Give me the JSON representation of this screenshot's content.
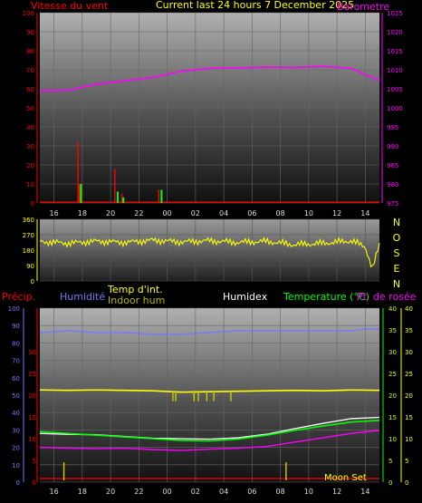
{
  "title": "Current last 24 hours 7 December 2025",
  "x_tick_labels": [
    "16",
    "18",
    "20",
    "22",
    "00",
    "02",
    "04",
    "06",
    "08",
    "10",
    "12",
    "14"
  ],
  "colors": {
    "wind": "#ff0000",
    "gust": "#00ff00",
    "barometer": "#ff00ff",
    "direction": "#ffff00",
    "rain": "#ff0000",
    "humidity": "#7777ff",
    "temp_int": "#ffff00",
    "indoor_hum": "#cccc00",
    "humidex": "#ffffff",
    "temperature": "#00ff00",
    "dewpoint": "#ff00ff"
  },
  "chart_data": [
    {
      "type": "line",
      "left_axis_label": "Vitesse du vent",
      "right_axis_label": "Barometre",
      "left_ticks": [
        "0",
        "10",
        "20",
        "30",
        "40",
        "50",
        "60",
        "70",
        "80",
        "90",
        "100"
      ],
      "right_ticks": [
        "975",
        "980",
        "985",
        "990",
        "995",
        "1000",
        "1005",
        "1010",
        "1015",
        "1020",
        "1025"
      ],
      "ylim_left": [
        0,
        100
      ],
      "ylim_right": [
        975,
        1025
      ],
      "xlim_hours": [
        15,
        39
      ],
      "series": [
        {
          "axis": "right",
          "x": [
            15,
            17,
            19,
            21,
            23,
            25,
            27,
            29,
            31,
            33,
            35,
            37,
            38,
            39
          ],
          "y": [
            1004.5,
            1004.6,
            1006.2,
            1007.1,
            1008.0,
            1009.6,
            1010.4,
            1010.5,
            1010.7,
            1010.6,
            1010.9,
            1010.4,
            1008.7,
            1007.2
          ]
        },
        {
          "axis": "left",
          "x": [
            17.7,
            17.8,
            20.3,
            20.8,
            23.4
          ],
          "y": [
            32,
            10,
            18,
            5,
            7
          ]
        },
        {
          "axis": "left",
          "x": [
            17.9,
            20.5,
            20.9,
            23.6
          ],
          "y": [
            10,
            6,
            3,
            7
          ]
        }
      ]
    },
    {
      "type": "line",
      "right_axis_letters": [
        "N",
        "O",
        "S",
        "E",
        "N"
      ],
      "left_ticks": [
        "0",
        "90",
        "180",
        "270",
        "360"
      ],
      "ylim": [
        0,
        360
      ],
      "xlim_hours": [
        15,
        39
      ],
      "series": [
        {
          "x": [
            15,
            17,
            19,
            21,
            23,
            25,
            27,
            29,
            31,
            33,
            35,
            37,
            38,
            38.5,
            39
          ],
          "y": [
            230,
            220,
            232,
            225,
            238,
            228,
            235,
            225,
            232,
            212,
            220,
            235,
            200,
            70,
            210
          ]
        }
      ]
    },
    {
      "type": "line",
      "labels": {
        "precip": "Précip.",
        "humidity": "Humidité",
        "temp_int": "Temp d'int.",
        "indoor_hum": "Indoor hum",
        "humidex": "Humidex",
        "temperature": "Temperature (°C)",
        "dewpoint": "Pt. de rosée",
        "moon": "Moon Set"
      },
      "precip_ticks": [
        "0",
        "10",
        "20",
        "30",
        "40",
        "50",
        "60",
        "70",
        "80",
        "90",
        "100"
      ],
      "temp_left_ticks": [
        "0",
        "5",
        "10",
        "15",
        "20",
        "25",
        "30"
      ],
      "temp_right_ticks": [
        "0",
        "5",
        "10",
        "15",
        "20",
        "25",
        "30",
        "35",
        "40"
      ],
      "ylim_precip": [
        0,
        100
      ],
      "ylim_temp": [
        0,
        40
      ],
      "xlim_hours": [
        15,
        39
      ],
      "series": [
        {
          "name": "Humidité",
          "axis": "precip",
          "x": [
            15,
            17,
            19,
            21,
            23,
            25,
            27,
            29,
            31,
            33,
            35,
            37,
            38,
            39
          ],
          "y": [
            86,
            87,
            86,
            86,
            85,
            85,
            86,
            87,
            87,
            87,
            87,
            87,
            88,
            88
          ]
        },
        {
          "name": "Temp d'int.",
          "axis": "temp",
          "x": [
            15,
            17,
            19,
            21,
            23,
            25,
            27,
            29,
            31,
            33,
            35,
            37,
            39
          ],
          "y": [
            21.2,
            21.1,
            21.2,
            21.1,
            21.0,
            20.7,
            20.8,
            20.9,
            21.0,
            21.1,
            21.0,
            21.2,
            21.1
          ]
        },
        {
          "name": "Indoor hum",
          "axis": "temp",
          "x": [
            24.4,
            24.6,
            25.9,
            26.2,
            26.8,
            27.3,
            28.5
          ],
          "y": [
            18.6,
            18.6,
            18.6,
            18.6,
            18.6,
            18.6,
            18.6
          ]
        },
        {
          "name": "Humidex",
          "axis": "temp",
          "x": [
            15,
            17,
            19,
            21,
            23,
            25,
            27,
            29,
            31,
            33,
            35,
            37,
            39
          ],
          "y": [
            11.2,
            11.0,
            10.9,
            10.5,
            10.1,
            10.0,
            9.9,
            10.2,
            11.0,
            12.3,
            13.5,
            14.6,
            14.9
          ]
        },
        {
          "name": "Temperature (°C)",
          "axis": "temp",
          "x": [
            15,
            17,
            19,
            21,
            23,
            25,
            27,
            29,
            31,
            33,
            35,
            37,
            39
          ],
          "y": [
            11.6,
            11.2,
            10.8,
            10.4,
            10.0,
            9.6,
            9.5,
            9.9,
            10.8,
            11.9,
            12.9,
            13.8,
            14.2
          ]
        },
        {
          "name": "Pt. de rosée",
          "axis": "temp",
          "x": [
            15,
            17,
            19,
            21,
            23,
            25,
            27,
            29,
            31,
            33,
            35,
            37,
            39
          ],
          "y": [
            8.0,
            7.8,
            7.7,
            7.8,
            7.5,
            7.3,
            7.6,
            7.8,
            8.2,
            9.2,
            10.2,
            11.2,
            11.9
          ]
        },
        {
          "name": "Précip.",
          "axis": "precip",
          "x": [
            15,
            39
          ],
          "y": [
            0,
            0
          ]
        },
        {
          "name": "Moon Set",
          "axis": "temp",
          "x": [
            16.7,
            32.4
          ],
          "y": [
            3,
            3
          ]
        }
      ]
    }
  ]
}
